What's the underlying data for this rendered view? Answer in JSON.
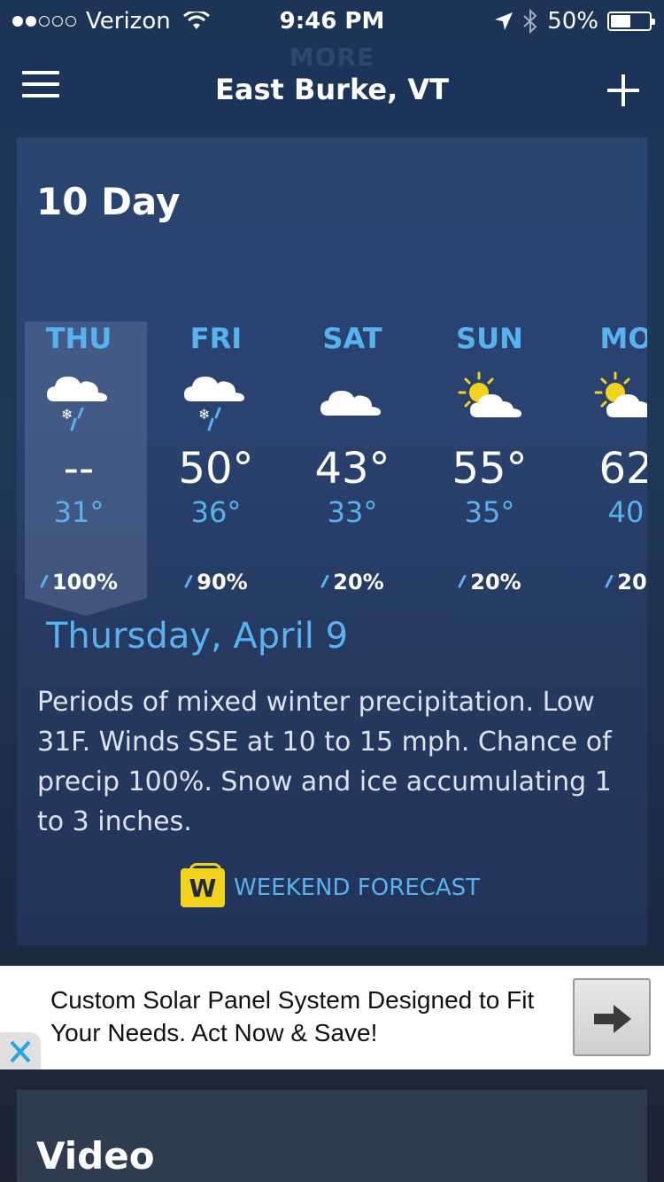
{
  "status": {
    "carrier": "Verizon",
    "time": "9:46 PM",
    "battery": "50%",
    "signal_bars_filled": 2,
    "signal_bars_total": 5,
    "battery_level": 0.5
  },
  "nav": {
    "ghost_label": "MORE",
    "location": "East Burke, VT"
  },
  "forecast": {
    "title": "10 Day",
    "days": [
      {
        "day": "THU",
        "icon": "snow-rain-icon",
        "high": "--",
        "low": "31°",
        "precip": "100%"
      },
      {
        "day": "FRI",
        "icon": "snow-rain-icon",
        "high": "50°",
        "low": "36°",
        "precip": "90%"
      },
      {
        "day": "SAT",
        "icon": "cloud-icon",
        "high": "43°",
        "low": "33°",
        "precip": "20%"
      },
      {
        "day": "SUN",
        "icon": "partly-sunny-icon",
        "high": "55°",
        "low": "35°",
        "precip": "20%"
      },
      {
        "day": "MO",
        "icon": "partly-sunny-icon",
        "high": "62",
        "low": "40",
        "precip": "20"
      }
    ],
    "selected_index": 0
  },
  "detail": {
    "date": "Thursday, April 9",
    "text": "Periods of mixed winter precipitation. Low 31F. Winds SSE at 10 to 15 mph. Chance of precip 100%. Snow and ice accumulating 1 to 3 inches."
  },
  "weekend": {
    "badge": "W",
    "label": "WEEKEND FORECAST"
  },
  "ad": {
    "text": "Custom Solar Panel System Designed to Fit Your Needs. Act Now & Save!"
  },
  "video": {
    "title": "Video"
  },
  "colors": {
    "accent": "#57b3f0",
    "badge": "#f2d21b"
  }
}
